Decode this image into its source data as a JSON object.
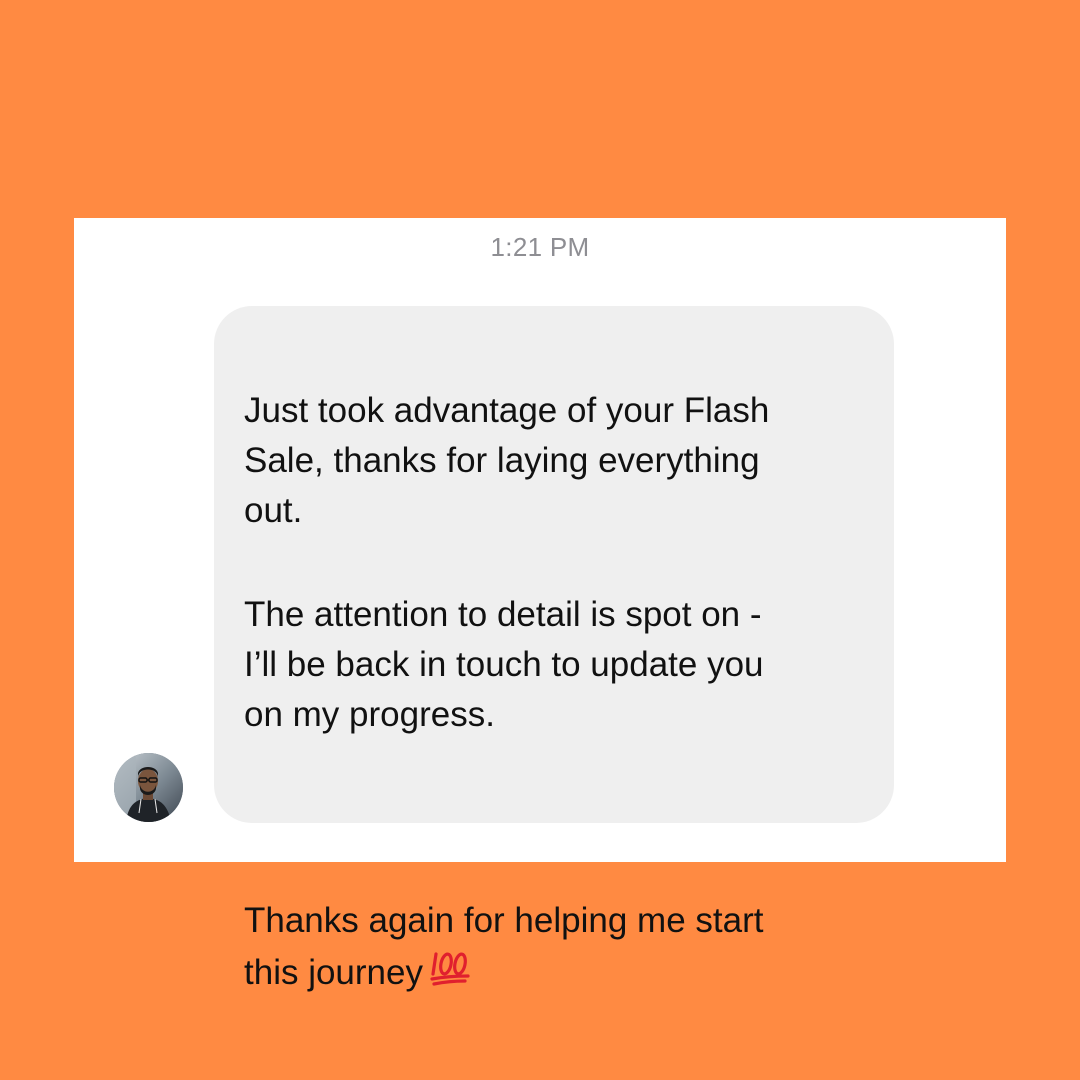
{
  "conversation": {
    "timestamp": "1:21 PM",
    "message": {
      "paragraph1": "Just took advantage of your Flash\nSale, thanks for laying everything\nout.",
      "paragraph2": "The attention to detail is spot on -\nI’ll be back in touch to update you\non my progress.",
      "paragraph3": "Thanks again for helping me start\nthis journey",
      "emoji": "hundred-points-icon"
    },
    "sender_avatar": "avatar-photo"
  },
  "colors": {
    "background": "#FF8A42",
    "card": "#FFFFFF",
    "bubble": "#EFEFEF",
    "timestamp": "#8E8E93",
    "text": "#111111",
    "emoji": "#E0202E"
  }
}
